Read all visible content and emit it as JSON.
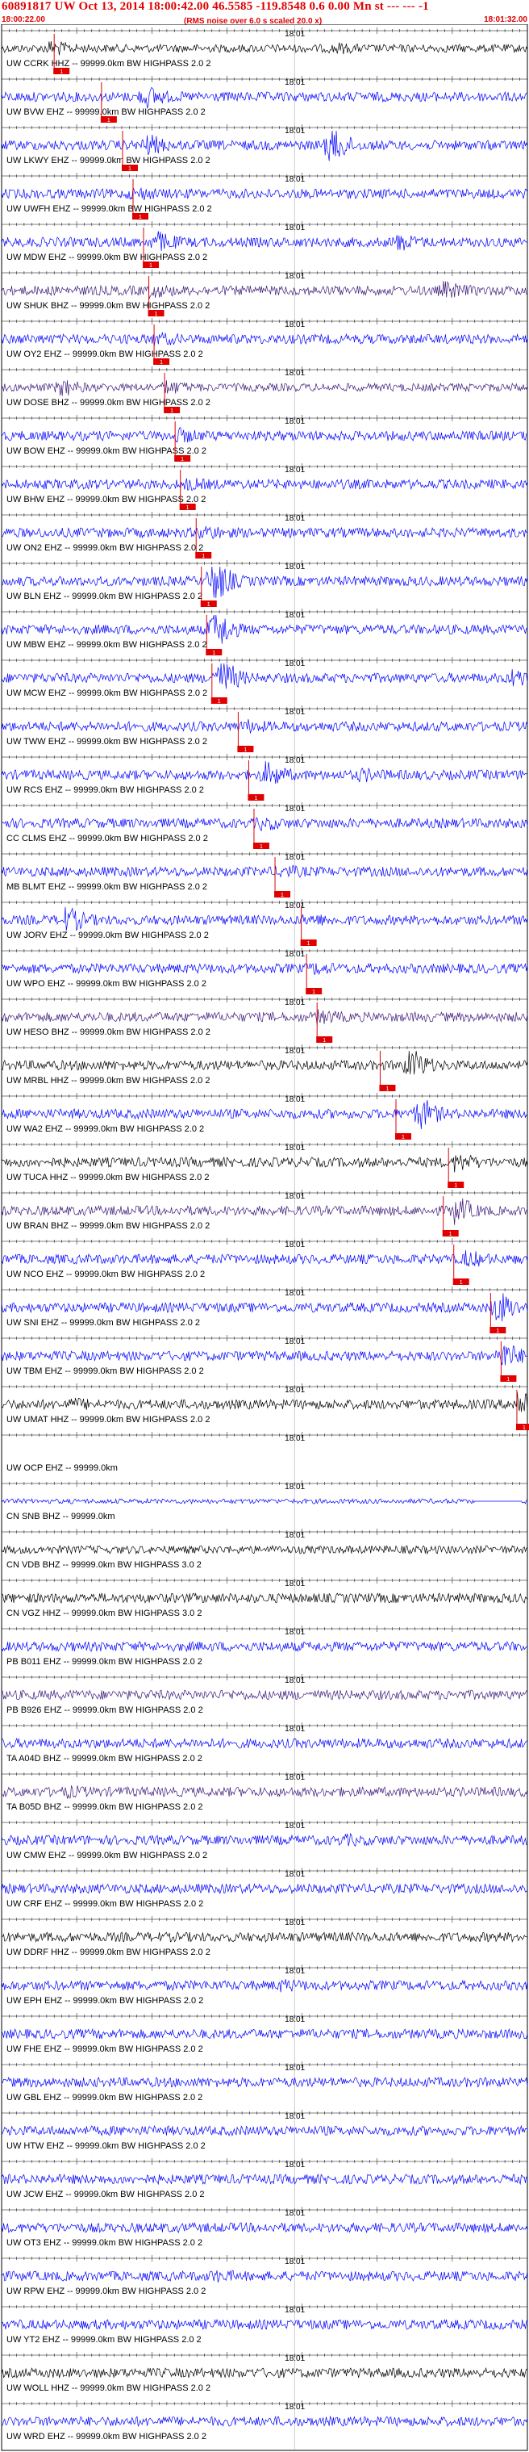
{
  "header": {
    "title": "60891817 UW Oct 13, 2014 18:00:42.00 46.5585 -119.8548 0.6 0.00 Mn st --- --- -1",
    "start_time": "18:00:22.00",
    "end_time": "18:01:32.00",
    "rms_note": "(RMS noise over 6.0 s scaled 20.0 x)"
  },
  "chart_data": {
    "type": "line",
    "minute_tick_label": "18:01",
    "pick_label": "1",
    "colors": {
      "blue": "#0000ff",
      "black": "#000000",
      "purple": "#3d1a7a",
      "red": "#e00000"
    },
    "traces": [
      {
        "label": "UW CCRK HHZ -- 99999.0km BW HIGHPASS 2.0 2",
        "color": "black",
        "amp": 5,
        "pick": 0.1,
        "bursts": [
          [
            0.09,
            2.2
          ],
          [
            0.63,
            1.6
          ]
        ]
      },
      {
        "label": "UW BVW EHZ -- 99999.0km BW HIGHPASS 2.0 2",
        "color": "blue",
        "amp": 6,
        "pick": 0.19,
        "bursts": [
          [
            0.27,
            2.5
          ]
        ]
      },
      {
        "label": "UW LKWY EHZ -- 99999.0km BW HIGHPASS 2.0 2",
        "color": "blue",
        "amp": 6,
        "pick": 0.23,
        "bursts": [
          [
            0.27,
            2.5
          ],
          [
            0.62,
            4.5
          ]
        ]
      },
      {
        "label": "UW UWFH EHZ -- 99999.0km BW HIGHPASS 2.0 2",
        "color": "blue",
        "amp": 6,
        "pick": 0.25,
        "bursts": [
          [
            0.25,
            1.6
          ]
        ]
      },
      {
        "label": "UW MDW EHZ -- 99999.0km BW HIGHPASS 2.0 2",
        "color": "blue",
        "amp": 6,
        "pick": 0.27,
        "bursts": [
          [
            0.29,
            2.5
          ],
          [
            0.75,
            2.0
          ]
        ]
      },
      {
        "label": "UW SHUK BHZ -- 99999.0km BW HIGHPASS 2.0 2",
        "color": "purple",
        "amp": 6,
        "pick": 0.28,
        "bursts": [
          [
            0.28,
            1.7
          ],
          [
            0.84,
            2.0
          ]
        ]
      },
      {
        "label": "UW OY2 EHZ -- 99999.0km BW HIGHPASS 2.0 2",
        "color": "blue",
        "amp": 6,
        "pick": 0.29,
        "bursts": [
          [
            0.29,
            1.6
          ]
        ]
      },
      {
        "label": "UW DOSE BHZ -- 99999.0km BW HIGHPASS 2.0 2",
        "color": "purple",
        "amp": 5,
        "pick": 0.31,
        "bursts": [
          [
            0.11,
            2.4
          ],
          [
            0.31,
            2.0
          ]
        ]
      },
      {
        "label": "UW BOW EHZ -- 99999.0km BW HIGHPASS 2.0 2",
        "color": "blue",
        "amp": 6,
        "pick": 0.33,
        "bursts": [
          [
            0.33,
            1.8
          ]
        ]
      },
      {
        "label": "UW BHW EHZ -- 99999.0km BW HIGHPASS 2.0 2",
        "color": "blue",
        "amp": 6,
        "pick": 0.34,
        "bursts": [
          [
            0.35,
            1.5
          ]
        ]
      },
      {
        "label": "UW ON2 EHZ -- 99999.0km BW HIGHPASS 2.0 2",
        "color": "blue",
        "amp": 6,
        "pick": 0.37,
        "bursts": [
          [
            0.38,
            1.8
          ]
        ]
      },
      {
        "label": "UW BLN EHZ -- 99999.0km BW HIGHPASS 2.0 2",
        "color": "blue",
        "amp": 6,
        "pick": 0.38,
        "bursts": [
          [
            0.4,
            4.5
          ]
        ]
      },
      {
        "label": "UW MBW EHZ -- 99999.0km BW HIGHPASS 2.0 2",
        "color": "blue",
        "amp": 6,
        "pick": 0.39,
        "bursts": [
          [
            0.4,
            4.5
          ]
        ]
      },
      {
        "label": "UW MCW EHZ -- 99999.0km BW HIGHPASS 2.0 2",
        "color": "blue",
        "amp": 6,
        "pick": 0.4,
        "bursts": [
          [
            0.41,
            4.5
          ],
          [
            0.97,
            2.2
          ]
        ]
      },
      {
        "label": "UW TWW EHZ -- 99999.0km BW HIGHPASS 2.0 2",
        "color": "blue",
        "amp": 6,
        "pick": 0.45,
        "bursts": [
          [
            0.46,
            1.6
          ]
        ]
      },
      {
        "label": "UW RCS EHZ -- 99999.0km BW HIGHPASS 2.0 2",
        "color": "blue",
        "amp": 6,
        "pick": 0.47,
        "bursts": [
          [
            0.5,
            2.8
          ],
          [
            0.68,
            1.6
          ]
        ]
      },
      {
        "label": "CC CLMS EHZ -- 99999.0km BW HIGHPASS 2.0 2",
        "color": "blue",
        "amp": 6,
        "pick": 0.48,
        "bursts": [
          [
            0.49,
            1.6
          ]
        ]
      },
      {
        "label": "MB BLMT EHZ -- 99999.0km BW HIGHPASS 2.0 2",
        "color": "blue",
        "amp": 6,
        "pick": 0.52,
        "bursts": [
          [
            0.53,
            1.5
          ]
        ]
      },
      {
        "label": "UW JORV EHZ -- 99999.0km BW HIGHPASS 2.0 2",
        "color": "blue",
        "amp": 6,
        "pick": 0.57,
        "bursts": [
          [
            0.12,
            2.8
          ],
          [
            0.58,
            1.5
          ]
        ]
      },
      {
        "label": "UW WPO EHZ -- 99999.0km BW HIGHPASS 2.0 2",
        "color": "blue",
        "amp": 6,
        "pick": 0.58,
        "bursts": [
          [
            0.59,
            1.5
          ]
        ]
      },
      {
        "label": "UW HESO BHZ -- 99999.0km BW HIGHPASS 2.0 2",
        "color": "purple",
        "amp": 6,
        "pick": 0.6,
        "bursts": [
          [
            0.6,
            1.7
          ]
        ]
      },
      {
        "label": "UW MRBL HHZ -- 99999.0km BW HIGHPASS 2.0 2",
        "color": "black",
        "amp": 6,
        "pick": 0.72,
        "bursts": [
          [
            0.77,
            4.0
          ]
        ]
      },
      {
        "label": "UW WA2 EHZ -- 99999.0km BW HIGHPASS 2.0 2",
        "color": "blue",
        "amp": 6,
        "pick": 0.75,
        "bursts": [
          [
            0.79,
            3.5
          ]
        ]
      },
      {
        "label": "UW TUCA HHZ -- 99999.0km BW HIGHPASS 2.0 2",
        "color": "black",
        "amp": 6,
        "pick": 0.85,
        "bursts": [
          [
            0.86,
            2.2
          ]
        ]
      },
      {
        "label": "UW BRAN BHZ -- 99999.0km BW HIGHPASS 2.0 2",
        "color": "purple",
        "amp": 6,
        "pick": 0.84,
        "bursts": [
          [
            0.86,
            3.0
          ]
        ]
      },
      {
        "label": "UW NCO EHZ -- 99999.0km BW HIGHPASS 2.0 2",
        "color": "blue",
        "amp": 6,
        "pick": 0.86,
        "bursts": [
          [
            0.88,
            2.0
          ]
        ]
      },
      {
        "label": "UW SNI EHZ -- 99999.0km BW HIGHPASS 2.0 2",
        "color": "blue",
        "amp": 6,
        "pick": 0.93,
        "bursts": [
          [
            0.94,
            3.5
          ]
        ]
      },
      {
        "label": "UW TBM EHZ -- 99999.0km BW HIGHPASS 2.0 2",
        "color": "blue",
        "amp": 6,
        "pick": 0.95,
        "bursts": [
          [
            0.95,
            3.0
          ]
        ]
      },
      {
        "label": "UW UMAT HHZ -- 99999.0km BW HIGHPASS 2.0 2",
        "color": "black",
        "amp": 6,
        "pick": 0.98,
        "bursts": [
          [
            0.98,
            3.5
          ],
          [
            0.13,
            1.5
          ]
        ]
      },
      {
        "label": "UW OCP EHZ -- 99999.0km",
        "color": "blue",
        "amp": 0,
        "pick": null,
        "bursts": []
      },
      {
        "label": "CN SNB BHZ -- 99999.0km",
        "color": "blue",
        "amp": 3,
        "pick": null,
        "bursts": [],
        "gaps": [
          [
            0.9,
            0.99
          ]
        ]
      },
      {
        "label": "CN VDB BHZ -- 99999.0km BW HIGHPASS 3.0 2",
        "color": "black",
        "amp": 5,
        "pick": null,
        "bursts": []
      },
      {
        "label": "CN VGZ HHZ -- 99999.0km BW HIGHPASS 3.0 2",
        "color": "black",
        "amp": 6,
        "pick": null,
        "bursts": []
      },
      {
        "label": "PB B011 EHZ -- 99999.0km BW HIGHPASS 2.0 2",
        "color": "blue",
        "amp": 6,
        "pick": null,
        "bursts": []
      },
      {
        "label": "PB B926 EHZ -- 99999.0km BW HIGHPASS 2.0 2",
        "color": "purple",
        "amp": 6,
        "pick": null,
        "bursts": []
      },
      {
        "label": "TA A04D BHZ -- 99999.0km BW HIGHPASS 2.0 2",
        "color": "blue",
        "amp": 6,
        "pick": null,
        "bursts": []
      },
      {
        "label": "TA B05D BHZ -- 99999.0km BW HIGHPASS 2.0 2",
        "color": "purple",
        "amp": 6,
        "pick": null,
        "bursts": [
          [
            0.12,
            1.5
          ]
        ]
      },
      {
        "label": "UW CMW EHZ -- 99999.0km BW HIGHPASS 2.0 2",
        "color": "blue",
        "amp": 6,
        "pick": null,
        "bursts": [
          [
            0.65,
            1.4
          ]
        ]
      },
      {
        "label": "UW CRF EHZ -- 99999.0km BW HIGHPASS 2.0 2",
        "color": "blue",
        "amp": 6,
        "pick": null,
        "bursts": []
      },
      {
        "label": "UW DDRF HHZ -- 99999.0km BW HIGHPASS 2.0 2",
        "color": "black",
        "amp": 6,
        "pick": null,
        "bursts": []
      },
      {
        "label": "UW EPH EHZ -- 99999.0km BW HIGHPASS 2.0 2",
        "color": "blue",
        "amp": 6,
        "pick": null,
        "bursts": [
          [
            0.53,
            1.5
          ]
        ]
      },
      {
        "label": "UW FHE EHZ -- 99999.0km BW HIGHPASS 2.0 2",
        "color": "blue",
        "amp": 6,
        "pick": null,
        "bursts": []
      },
      {
        "label": "UW GBL EHZ -- 99999.0km BW HIGHPASS 2.0 2",
        "color": "blue",
        "amp": 6,
        "pick": null,
        "bursts": []
      },
      {
        "label": "UW HTW EHZ -- 99999.0km BW HIGHPASS 2.0 2",
        "color": "blue",
        "amp": 6,
        "pick": null,
        "bursts": []
      },
      {
        "label": "UW JCW EHZ -- 99999.0km BW HIGHPASS 2.0 2",
        "color": "blue",
        "amp": 6,
        "pick": null,
        "bursts": []
      },
      {
        "label": "UW OT3 EHZ -- 99999.0km BW HIGHPASS 2.0 2",
        "color": "blue",
        "amp": 6,
        "pick": null,
        "bursts": []
      },
      {
        "label": "UW RPW EHZ -- 99999.0km BW HIGHPASS 2.0 2",
        "color": "blue",
        "amp": 6,
        "pick": null,
        "bursts": [
          [
            0.4,
            1.5
          ]
        ]
      },
      {
        "label": "UW YT2 EHZ -- 99999.0km BW HIGHPASS 2.0 2",
        "color": "blue",
        "amp": 6,
        "pick": null,
        "bursts": []
      },
      {
        "label": "UW WOLL HHZ -- 99999.0km BW HIGHPASS 2.0 2",
        "color": "black",
        "amp": 6,
        "pick": null,
        "bursts": []
      },
      {
        "label": "UW WRD EHZ -- 99999.0km BW HIGHPASS 2.0 2",
        "color": "blue",
        "amp": 6,
        "pick": null,
        "bursts": []
      }
    ]
  }
}
